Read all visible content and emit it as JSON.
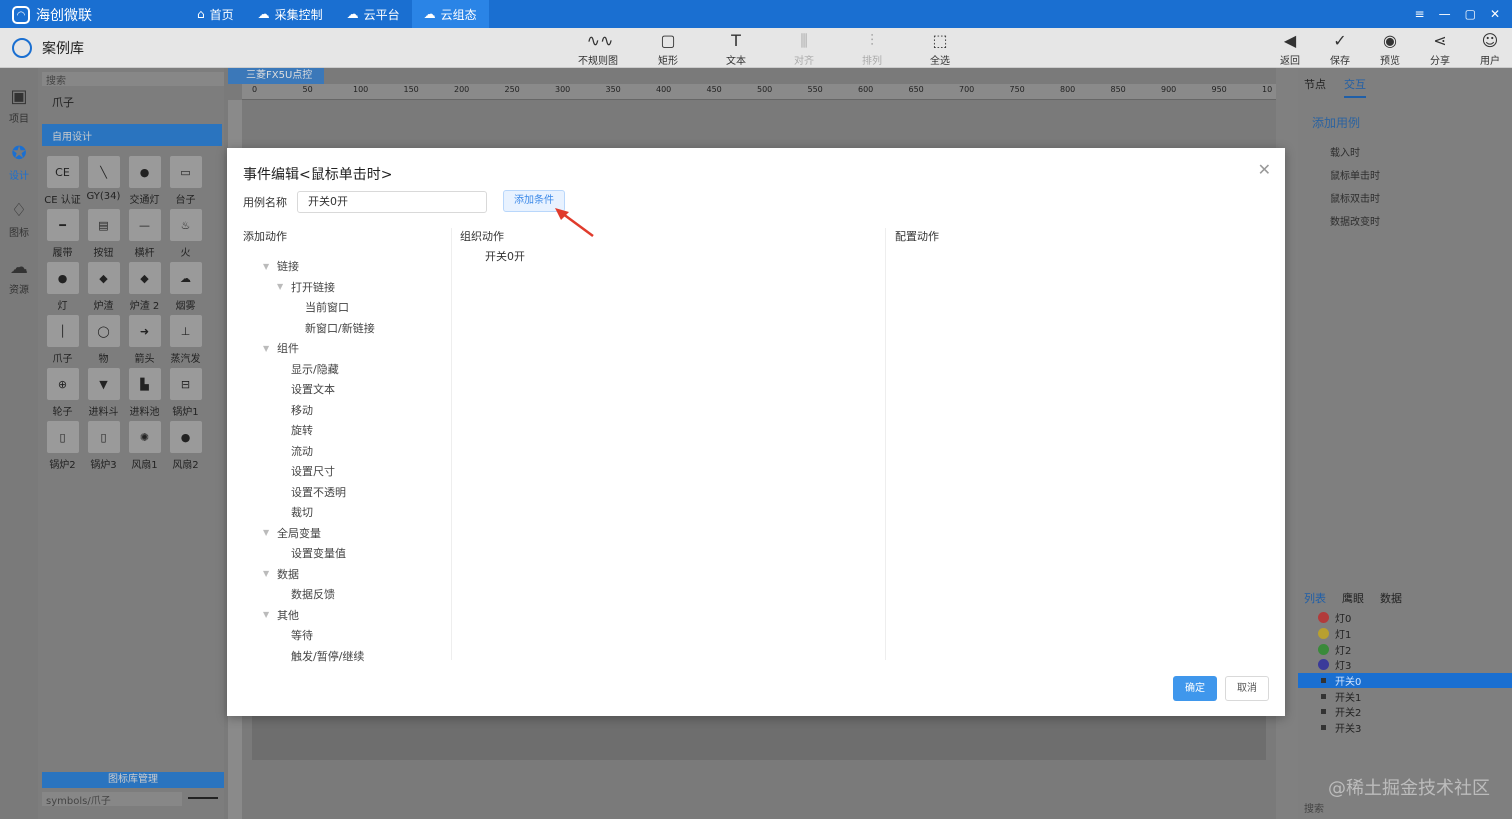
{
  "app": {
    "brand": "海创微联",
    "nav": [
      "首页",
      "采集控制",
      "云平台",
      "云组态"
    ],
    "active_nav": 3,
    "window_controls": [
      "≡",
      "—",
      "▢",
      "✕"
    ]
  },
  "subbar": {
    "title": "案例库",
    "tools": [
      {
        "label": "不规则图形",
        "icon": "irregular-shape-icon",
        "glyph": "∿∿",
        "disabled": false
      },
      {
        "label": "矩形",
        "icon": "rectangle-icon",
        "glyph": "▢",
        "disabled": false
      },
      {
        "label": "文本",
        "icon": "text-icon",
        "glyph": "T",
        "disabled": false
      },
      {
        "label": "对齐",
        "icon": "align-icon",
        "glyph": "⫼",
        "disabled": true
      },
      {
        "label": "排列",
        "icon": "arrange-icon",
        "glyph": "⫶",
        "disabled": true
      },
      {
        "label": "全选",
        "icon": "select-all-icon",
        "glyph": "⬚",
        "disabled": false
      }
    ],
    "right_tools": [
      {
        "label": "返回",
        "icon": "back-icon",
        "glyph": "◀"
      },
      {
        "label": "保存",
        "icon": "save-icon",
        "glyph": "✓"
      },
      {
        "label": "预览",
        "icon": "preview-icon",
        "glyph": "◉"
      },
      {
        "label": "分享",
        "icon": "share-icon",
        "glyph": "⋖"
      },
      {
        "label": "用户",
        "icon": "user-icon",
        "glyph": "☺"
      }
    ]
  },
  "rail": [
    {
      "label": "项目",
      "icon": "project-icon",
      "glyph": "▣",
      "active": false
    },
    {
      "label": "设计",
      "icon": "design-icon",
      "glyph": "✪",
      "active": true
    },
    {
      "label": "图标",
      "icon": "icons-icon",
      "glyph": "♢",
      "active": false
    },
    {
      "label": "资源",
      "icon": "resource-icon",
      "glyph": "☁",
      "active": false
    }
  ],
  "components": {
    "search_placeholder": "搜索",
    "category": "爪子",
    "group": "自用设计",
    "items": [
      "CE 认证",
      "GY(34)",
      "交通灯",
      "台子",
      "履带",
      "按钮",
      "横杆",
      "火",
      "灯",
      "炉渣",
      "炉渣 2",
      "烟雾",
      "爪子",
      "物",
      "箭头",
      "蒸汽发",
      "轮子",
      "进料斗",
      "进料池",
      "锅炉1",
      "锅炉2",
      "锅炉3",
      "风扇1",
      "风扇2"
    ],
    "library_bar": "图标库管理",
    "library_path": "symbols/爪子"
  },
  "canvas": {
    "tab": "三菱FX5U点控",
    "ruler_labels": [
      "0",
      "50",
      "100",
      "150",
      "200",
      "250",
      "300",
      "350",
      "400",
      "450",
      "500",
      "550",
      "600",
      "650",
      "700",
      "750",
      "800",
      "850",
      "900",
      "950",
      "10"
    ]
  },
  "right_panel": {
    "tabs": [
      "节点",
      "交互"
    ],
    "active_tab": 1,
    "add_case": "添加用例",
    "events": [
      "载入时",
      "鼠标单击时",
      "鼠标双击时",
      "数据改变时"
    ]
  },
  "layers_panel": {
    "tabs": [
      "列表",
      "鹰眼",
      "数据"
    ],
    "items": [
      {
        "label": "灯0",
        "color": "#b23b3b",
        "type": "dot"
      },
      {
        "label": "灯1",
        "color": "#b8a030",
        "type": "dot"
      },
      {
        "label": "灯2",
        "color": "#3a8a3a",
        "type": "dot"
      },
      {
        "label": "灯3",
        "color": "#3a3a9a",
        "type": "dot"
      },
      {
        "label": "开关0",
        "color": "",
        "type": "sq",
        "selected": true
      },
      {
        "label": "开关1",
        "color": "",
        "type": "sq"
      },
      {
        "label": "开关2",
        "color": "",
        "type": "sq"
      },
      {
        "label": "开关3",
        "color": "",
        "type": "sq"
      }
    ],
    "search": "搜索"
  },
  "watermark": "@稀土掘金技术社区",
  "modal": {
    "title": "事件编辑<鼠标单击时>",
    "case_name_label": "用例名称",
    "case_name_value": "开关0开",
    "add_condition": "添加条件",
    "col_add_action": "添加动作",
    "col_organize": "组织动作",
    "col_config": "配置动作",
    "tree": [
      {
        "label": "链接",
        "level": 0,
        "caret": true
      },
      {
        "label": "打开链接",
        "level": 1,
        "caret": true
      },
      {
        "label": "当前窗口",
        "level": 2,
        "caret": false
      },
      {
        "label": "新窗口/新链接",
        "level": 2,
        "caret": false
      },
      {
        "label": "组件",
        "level": 0,
        "caret": true
      },
      {
        "label": "显示/隐藏",
        "level": 1,
        "caret": false
      },
      {
        "label": "设置文本",
        "level": 1,
        "caret": false
      },
      {
        "label": "移动",
        "level": 1,
        "caret": false
      },
      {
        "label": "旋转",
        "level": 1,
        "caret": false
      },
      {
        "label": "流动",
        "level": 1,
        "caret": false
      },
      {
        "label": "设置尺寸",
        "level": 1,
        "caret": false
      },
      {
        "label": "设置不透明",
        "level": 1,
        "caret": false
      },
      {
        "label": "裁切",
        "level": 1,
        "caret": false
      },
      {
        "label": "全局变量",
        "level": 0,
        "caret": true
      },
      {
        "label": "设置变量值",
        "level": 1,
        "caret": false
      },
      {
        "label": "数据",
        "level": 0,
        "caret": true
      },
      {
        "label": "数据反馈",
        "level": 1,
        "caret": false
      },
      {
        "label": "其他",
        "level": 0,
        "caret": true
      },
      {
        "label": "等待",
        "level": 1,
        "caret": false
      },
      {
        "label": "触发/暂停/继续",
        "level": 1,
        "caret": false
      }
    ],
    "organized_actions": [
      "开关0开"
    ],
    "ok": "确定",
    "cancel": "取消",
    "close": "✕"
  }
}
